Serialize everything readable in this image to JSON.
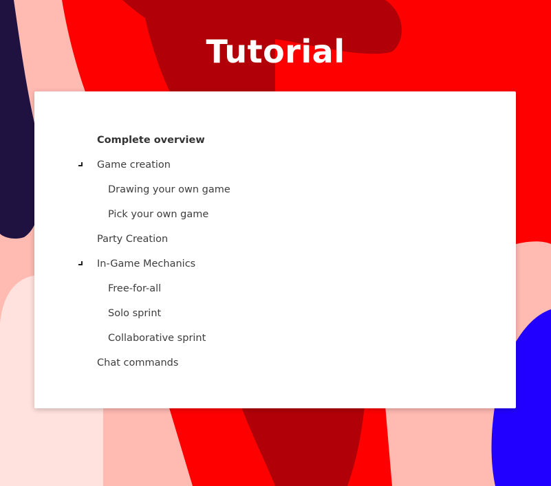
{
  "page": {
    "title": "Tutorial"
  },
  "toc": {
    "items": [
      {
        "label": "Complete overview",
        "level": 1,
        "expandable": false,
        "active": true
      },
      {
        "label": "Game creation",
        "level": 1,
        "expandable": true,
        "active": false
      },
      {
        "label": "Drawing your own game",
        "level": 2,
        "expandable": false,
        "active": false
      },
      {
        "label": "Pick your own game",
        "level": 2,
        "expandable": false,
        "active": false
      },
      {
        "label": "Party Creation",
        "level": 1,
        "expandable": false,
        "active": false
      },
      {
        "label": "In-Game Mechanics",
        "level": 1,
        "expandable": true,
        "active": false
      },
      {
        "label": "Free-for-all",
        "level": 2,
        "expandable": false,
        "active": false
      },
      {
        "label": "Solo sprint",
        "level": 2,
        "expandable": false,
        "active": false
      },
      {
        "label": "Collaborative sprint",
        "level": 2,
        "expandable": false,
        "active": false
      },
      {
        "label": "Chat commands",
        "level": 1,
        "expandable": false,
        "active": false
      }
    ]
  },
  "colors": {
    "background_base": "#ffbab2",
    "bright_red": "#ff0000",
    "dark_red": "#b20008",
    "navy": "#1f1240",
    "blue": "#2200ff",
    "pale_pink": "#ffe1dd",
    "card_background": "#ffffff",
    "text": "#3d3d3d"
  },
  "icons": {
    "expander": "corner-expander-icon"
  }
}
